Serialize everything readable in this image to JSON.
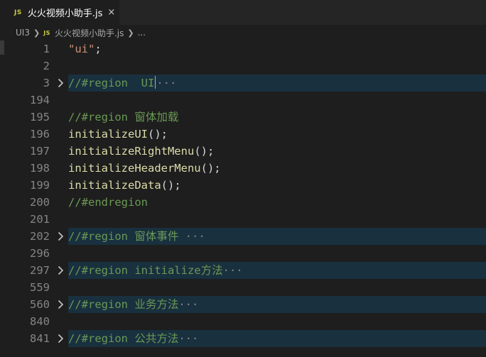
{
  "tab": {
    "badge": "JS",
    "title": "火火视频小助手.js",
    "close": "×"
  },
  "breadcrumb": {
    "folder": "UI3",
    "badge": "JS",
    "file": "火火视频小助手.js",
    "more": "..."
  },
  "lines": [
    {
      "n": "1",
      "folded": false,
      "parts": [
        {
          "t": "\"ui\"",
          "c": "str"
        },
        {
          "t": ";",
          "c": "plain"
        }
      ]
    },
    {
      "n": "2",
      "folded": false,
      "parts": []
    },
    {
      "n": "3",
      "folded": true,
      "parts": [
        {
          "t": "//#region  UI",
          "c": "cm"
        }
      ],
      "cursor": true,
      "ellipsis": "···"
    },
    {
      "n": "194",
      "folded": false,
      "parts": []
    },
    {
      "n": "195",
      "folded": false,
      "parts": [
        {
          "t": "//#region 窗体加载",
          "c": "cm"
        }
      ]
    },
    {
      "n": "196",
      "folded": false,
      "parts": [
        {
          "t": "initializeUI",
          "c": "fn"
        },
        {
          "t": "();",
          "c": "plain"
        }
      ]
    },
    {
      "n": "197",
      "folded": false,
      "parts": [
        {
          "t": "initializeRightMenu",
          "c": "fn"
        },
        {
          "t": "();",
          "c": "plain"
        }
      ]
    },
    {
      "n": "198",
      "folded": false,
      "parts": [
        {
          "t": "initializeHeaderMenu",
          "c": "fn"
        },
        {
          "t": "();",
          "c": "plain"
        }
      ]
    },
    {
      "n": "199",
      "folded": false,
      "parts": [
        {
          "t": "initializeData",
          "c": "fn"
        },
        {
          "t": "();",
          "c": "plain"
        }
      ]
    },
    {
      "n": "200",
      "folded": false,
      "parts": [
        {
          "t": "//#endregion",
          "c": "cm"
        }
      ]
    },
    {
      "n": "201",
      "folded": false,
      "parts": []
    },
    {
      "n": "202",
      "folded": true,
      "parts": [
        {
          "t": "//#region 窗体事件 ",
          "c": "cm"
        }
      ],
      "ellipsis": "···"
    },
    {
      "n": "296",
      "folded": false,
      "parts": []
    },
    {
      "n": "297",
      "folded": true,
      "parts": [
        {
          "t": "//#region initialize方法",
          "c": "cm"
        }
      ],
      "ellipsis": "···"
    },
    {
      "n": "559",
      "folded": false,
      "parts": []
    },
    {
      "n": "560",
      "folded": true,
      "parts": [
        {
          "t": "//#region 业务方法",
          "c": "cm"
        }
      ],
      "ellipsis": "···"
    },
    {
      "n": "840",
      "folded": false,
      "parts": []
    },
    {
      "n": "841",
      "folded": true,
      "parts": [
        {
          "t": "//#region 公共方法",
          "c": "cm"
        }
      ],
      "ellipsis": "···"
    }
  ]
}
